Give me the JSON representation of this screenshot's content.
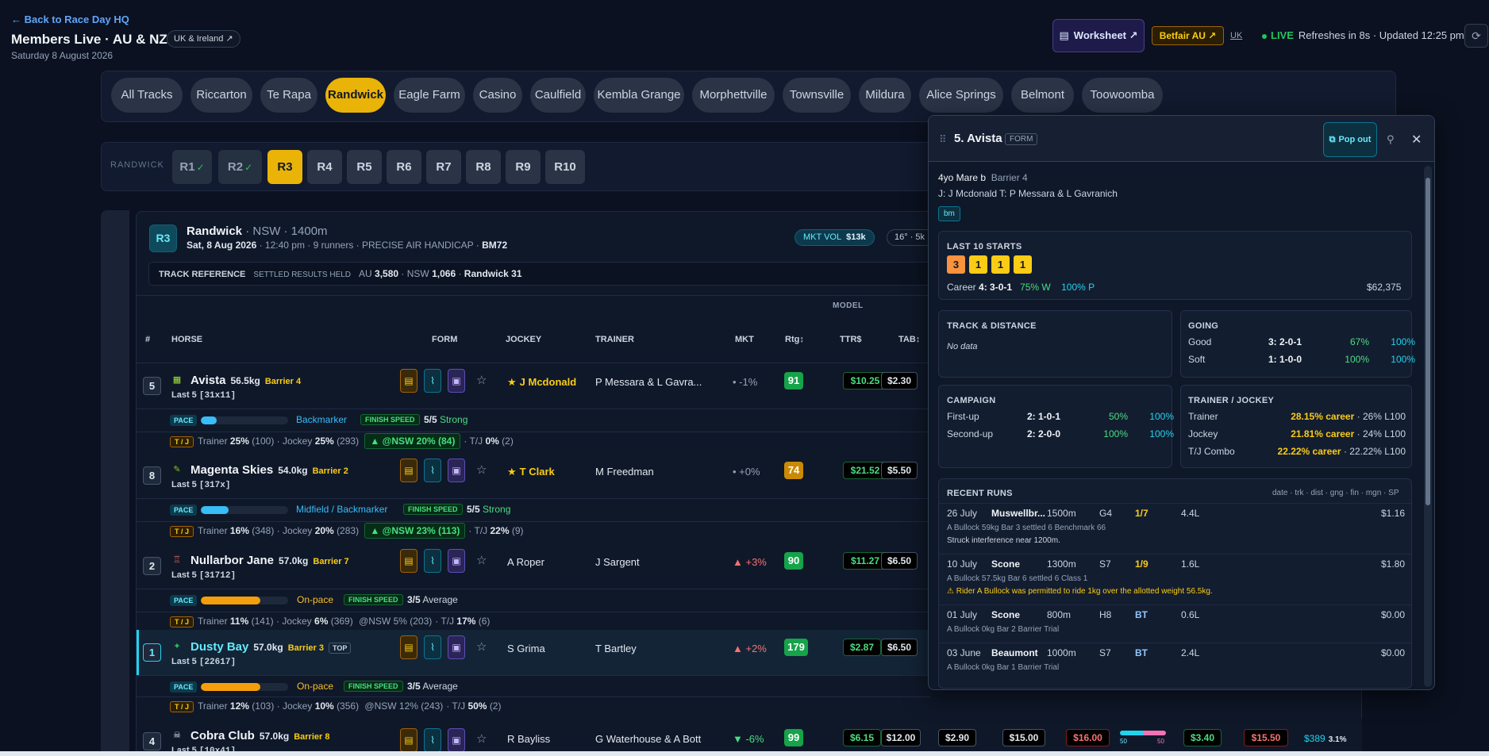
{
  "header": {
    "back_label": "← Back to Race Day HQ",
    "title": "Members Live · AU & NZ",
    "region_badge": "UK & Ireland ↗",
    "date": "Saturday 8 August 2026",
    "worksheet_label": "Worksheet ↗",
    "betfair_label": "Betfair AU ↗",
    "uk_link": "UK",
    "live_label": "LIVE",
    "refresh_text": "Refreshes in 8s · Updated 12:25 pm"
  },
  "tracks": [
    "All Tracks",
    "Riccarton",
    "Te Rapa",
    "Randwick",
    "Eagle Farm",
    "Casino",
    "Caulfield",
    "Kembla Grange",
    "Morphettville",
    "Townsville",
    "Mildura",
    "Alice Springs",
    "Belmont",
    "Toowoomba"
  ],
  "active_track": "Randwick",
  "races": {
    "label": "RANDWICK",
    "items": [
      "R1",
      "R2",
      "R3",
      "R4",
      "R5",
      "R6",
      "R7",
      "R8",
      "R9",
      "R10"
    ],
    "done_marks": [
      "✓",
      "✓"
    ],
    "active": "R3"
  },
  "race": {
    "badge": "R3",
    "track": "Randwick",
    "title_rest": " · NSW · 1400m",
    "date": "Sat, 8 Aug 2026",
    "sub_rest": " · 12:40 pm · 9 runners · PRECISE AIR HANDICAP · ",
    "class": "BM72",
    "mkt_vol_label": "MKT VOL",
    "mkt_vol_value": "$13k",
    "weather": "16° · 5k",
    "track_ref_label": "TRACK REFERENCE",
    "track_ref_settled": "SETTLED RESULTS HELD",
    "au_label": "AU",
    "au_value": "3,580",
    "nsw_label": "NSW",
    "nsw_value": "1,066",
    "randwick_ref": "Randwick 31"
  },
  "columns": {
    "model": "MODEL",
    "num": "#",
    "horse": "HORSE",
    "form": "FORM",
    "jockey": "JOCKEY",
    "trainer": "TRAINER",
    "mkt": "MKT",
    "rtg": "Rtg↕",
    "ttr": "TTR$",
    "tab": "TAB↕"
  },
  "runners": [
    {
      "num": "5",
      "name": "Avista",
      "weight": "56.5kg",
      "barrier": "Barrier 4",
      "top": "",
      "last5_label": "Last 5",
      "last5": "[31x11]",
      "jockey": "J Mcdonald",
      "jockey_star": "★",
      "trainer": "P Messara & L Gavra...",
      "mkt": "• -1%",
      "mkt_color": "#94a3b8",
      "rtg": "91",
      "rtg_color": "#16a34a",
      "ttr": "$10.25",
      "tab": "$2.30",
      "pace_label": "PACE",
      "pace": "Backmarker",
      "pace_pct": 0.18,
      "pace_color": "#38bdf8",
      "fs_label": "FINISH SPEED",
      "fs": "5/5",
      "fs_desc": "Strong",
      "tj_label": "T / J",
      "trainer_stat": "25%",
      "trainer_n": "(100)",
      "jockey_stat": "25%",
      "jockey_n": "(293)",
      "nsw": "▲ @NSW 20% (84)",
      "tj_combo": "0%",
      "tj_n": "(2)"
    },
    {
      "num": "8",
      "name": "Magenta Skies",
      "weight": "54.0kg",
      "barrier": "Barrier 2",
      "top": "",
      "last5_label": "Last 5",
      "last5": "[317x]",
      "jockey": "T Clark",
      "jockey_star": "★",
      "trainer": "M Freedman",
      "mkt": "• +0%",
      "mkt_color": "#94a3b8",
      "rtg": "74",
      "rtg_color": "#ca8a04",
      "ttr": "$21.52",
      "tab": "$5.50",
      "pace_label": "PACE",
      "pace": "Midfield / Backmarker",
      "pace_pct": 0.32,
      "pace_color": "#38bdf8",
      "fs_label": "FINISH SPEED",
      "fs": "5/5",
      "fs_desc": "Strong",
      "tj_label": "T / J",
      "trainer_stat": "16%",
      "trainer_n": "(348)",
      "jockey_stat": "20%",
      "jockey_n": "(283)",
      "nsw": "▲ @NSW 23% (113)",
      "tj_combo": "22%",
      "tj_n": "(9)"
    },
    {
      "num": "2",
      "name": "Nullarbor Jane",
      "weight": "57.0kg",
      "barrier": "Barrier 7",
      "top": "",
      "last5_label": "Last 5",
      "last5": "[31712]",
      "jockey": "A Roper",
      "jockey_star": "",
      "trainer": "J Sargent",
      "mkt": "▲ +3%",
      "mkt_color": "#f87171",
      "rtg": "90",
      "rtg_color": "#16a34a",
      "ttr": "$11.27",
      "tab": "$6.50",
      "pace_label": "PACE",
      "pace": "On-pace",
      "pace_pct": 0.68,
      "pace_color": "#f59e0b",
      "fs_label": "FINISH SPEED",
      "fs": "3/5",
      "fs_desc": "Average",
      "tj_label": "T / J",
      "trainer_stat": "11%",
      "trainer_n": "(141)",
      "jockey_stat": "6%",
      "jockey_n": "(369)",
      "nsw": "@NSW 5% (203)",
      "tj_combo": "17%",
      "tj_n": "(6)"
    },
    {
      "num": "1",
      "name": "Dusty Bay",
      "weight": "57.0kg",
      "barrier": "Barrier 3",
      "top": "TOP",
      "last5_label": "Last 5",
      "last5": "[22617]",
      "jockey": "S Grima",
      "jockey_star": "",
      "trainer": "T Bartley",
      "mkt": "▲ +2%",
      "mkt_color": "#f87171",
      "rtg": "179",
      "rtg_color": "#16a34a",
      "ttr": "$2.87",
      "tab": "$6.50",
      "pace_label": "PACE",
      "pace": "On-pace",
      "pace_pct": 0.68,
      "pace_color": "#f59e0b",
      "fs_label": "FINISH SPEED",
      "fs": "3/5",
      "fs_desc": "Average",
      "tj_label": "T / J",
      "trainer_stat": "12%",
      "trainer_n": "(103)",
      "jockey_stat": "10%",
      "jockey_n": "(356)",
      "nsw": "@NSW 12% (243)",
      "tj_combo": "50%",
      "tj_n": "(2)"
    },
    {
      "num": "4",
      "name": "Cobra Club",
      "weight": "57.0kg",
      "barrier": "Barrier 8",
      "top": "",
      "last5_label": "Last 5",
      "last5": "[10x41]",
      "jockey": "R Bayliss",
      "jockey_star": "",
      "trainer": "G Waterhouse & A Bott",
      "mkt": "▼ -6%",
      "mkt_color": "#4ade80",
      "rtg": "99",
      "rtg_color": "#16a34a",
      "ttr": "$6.15",
      "tab": "$12.00",
      "extra": [
        "$2.90",
        "$15.00",
        "$16.00",
        "$3.40",
        "$15.50",
        "$389"
      ],
      "extra_pct": "3.1%",
      "split_a": "50",
      "split_b": "50"
    }
  ],
  "labels": {
    "trainer": "Trainer",
    "jockey": "· Jockey",
    "tj": "· T/J"
  },
  "popout": {
    "title": "5. Avista",
    "tag": "FORM",
    "popout_label": "Pop out",
    "profile": "4yo Mare b",
    "barrier": "Barrier 4",
    "jt": "J: J Mcdonald   T: P Messara & L Gavranich",
    "tag_bm": "bm",
    "last10_title": "LAST 10 STARTS",
    "last10": [
      "3",
      "1",
      "1",
      "1"
    ],
    "career_label": "Career",
    "career_record": "4: 3-0-1",
    "career_win": "75% W",
    "career_place": "100% P",
    "career_prize": "$62,375",
    "td_title": "TRACK & DISTANCE",
    "td_nodata": "No data",
    "going_title": "GOING",
    "going": [
      {
        "label": "Good",
        "rec": "3: 2-0-1",
        "w": "67%",
        "p": "100%"
      },
      {
        "label": "Soft",
        "rec": "1: 1-0-0",
        "w": "100%",
        "p": "100%"
      }
    ],
    "campaign_title": "CAMPAIGN",
    "campaign": [
      {
        "label": "First-up",
        "rec": "2: 1-0-1",
        "w": "50%",
        "p": "100%"
      },
      {
        "label": "Second-up",
        "rec": "2: 2-0-0",
        "w": "100%",
        "p": "100%"
      }
    ],
    "tj_title": "TRAINER / JOCKEY",
    "tj": [
      {
        "label": "Trainer",
        "career": "28.15% career",
        "l100": "· 26% L100"
      },
      {
        "label": "Jockey",
        "career": "21.81% career",
        "l100": "· 24% L100"
      },
      {
        "label": "T/J Combo",
        "career": "22.22% career",
        "l100": "· 22.22% L100"
      }
    ],
    "recent_title": "RECENT RUNS",
    "recent_legend": "date · trk · dist · gng · fin · mgn · SP",
    "runs": [
      {
        "date": "26 July",
        "trk": "Muswellbr...",
        "dist": "1500m",
        "gng": "G4",
        "fin": "1/7",
        "mgn": "4.4L",
        "sp": "$1.16",
        "detail": "A Bullock   59kg   Bar 3   settled 6   Benchmark 66",
        "note": "Struck interference near 1200m.",
        "warn": ""
      },
      {
        "date": "10 July",
        "trk": "Scone",
        "dist": "1300m",
        "gng": "S7",
        "fin": "1/9",
        "mgn": "1.6L",
        "sp": "$1.80",
        "detail": "A Bullock   57.5kg   Bar 6   settled 6   Class 1",
        "note": "",
        "warn": "⚠ Rider A Bullock was permitted to ride 1kg over the allotted weight 56.5kg."
      },
      {
        "date": "01 July",
        "trk": "Scone",
        "dist": "800m",
        "gng": "H8",
        "fin": "BT",
        "mgn": "0.6L",
        "sp": "$0.00",
        "detail": "A Bullock   0kg   Bar 2   Barrier Trial",
        "note": "",
        "warn": ""
      },
      {
        "date": "03 June",
        "trk": "Beaumont",
        "dist": "1000m",
        "gng": "S7",
        "fin": "BT",
        "mgn": "2.4L",
        "sp": "$0.00",
        "detail": "A Bullock   0kg   Bar 1   Barrier Trial",
        "note": "",
        "warn": ""
      }
    ]
  }
}
